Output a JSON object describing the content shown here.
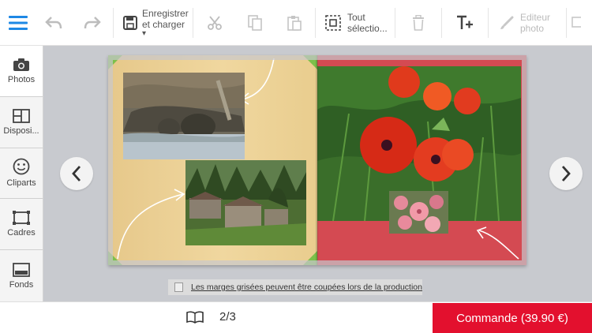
{
  "toolbar": {
    "save_label_line1": "Enregistrer",
    "save_label_line2": "et charger",
    "save_caret": "▾",
    "select_all_line1": "Tout",
    "select_all_line2": "sélectio...",
    "photo_editor_line1": "Editeur",
    "photo_editor_line2": "photo"
  },
  "sidebar": {
    "items": [
      {
        "label": "Photos",
        "icon": "camera-icon",
        "active": true
      },
      {
        "label": "Disposi...",
        "icon": "layout-icon"
      },
      {
        "label": "Cliparts",
        "icon": "smiley-icon"
      },
      {
        "label": "Cadres",
        "icon": "frame-icon"
      },
      {
        "label": "Fonds",
        "icon": "background-icon"
      }
    ]
  },
  "canvas": {
    "margin_note": "Les marges grisées peuvent être coupées lors de la production"
  },
  "footer": {
    "page_indicator": "2/3",
    "order_button": "Commande (39.90 €)"
  },
  "colors": {
    "accent_blue": "#1e88e5",
    "order_red": "#e3102e",
    "right_page_red": "#d44a52",
    "left_page_gold": "#f0d79f"
  }
}
